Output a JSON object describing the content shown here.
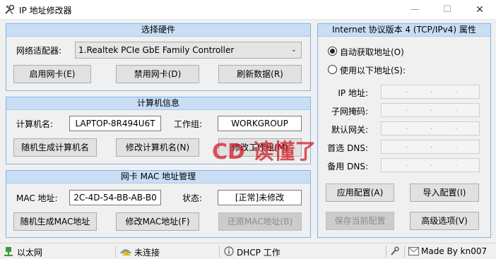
{
  "window": {
    "title": "IP 地址修改器"
  },
  "hardware": {
    "header": "选择硬件",
    "adapter_label": "网络适配器:",
    "adapter_value": "1.Realtek PCIe GbE Family Controller",
    "enable_label": "启用网卡(E)",
    "disable_label": "禁用网卡(D)",
    "refresh_label": "刷新数据(R)"
  },
  "computer": {
    "header": "计算机信息",
    "name_label": "计算机名:",
    "name_value": "LAPTOP-8R494U6T",
    "workgroup_label": "工作组:",
    "workgroup_value": "WORKGROUP",
    "random_name_label": "随机生成计算机名",
    "modify_name_label": "修改计算机名(N)",
    "modify_workgroup_label": "修改工作组(M)"
  },
  "mac": {
    "header": "网卡 MAC 地址管理",
    "address_label": "MAC 地址:",
    "address_value": "2C-4D-54-BB-AB-B0",
    "status_label": "状态:",
    "status_value": "[正常]未修改",
    "random_mac_label": "随机生成MAC地址",
    "modify_mac_label": "修改MAC地址(F)",
    "restore_mac_label": "还原MAC地址(B)"
  },
  "tcpip": {
    "header": "Internet 协议版本 4 (TCP/IPv4) 属性",
    "auto_label": "自动获取地址(O)",
    "manual_label": "使用以下地址(S):",
    "auto_selected": true,
    "ip_label": "IP 地址:",
    "mask_label": "子网掩码:",
    "gateway_label": "默认网关:",
    "dns1_label": "首选 DNS:",
    "dns2_label": "备用 DNS:",
    "apply_label": "应用配置(A)",
    "import_label": "导入配置(I)",
    "save_label": "保存当前配置",
    "advanced_label": "高级选项(V)"
  },
  "statusbar": {
    "network_type": "以太网",
    "connection": "未连接",
    "dhcp": "DHCP 工作",
    "credit": "Made By kn007"
  },
  "watermark": {
    "text": "CD 读懂了"
  }
}
